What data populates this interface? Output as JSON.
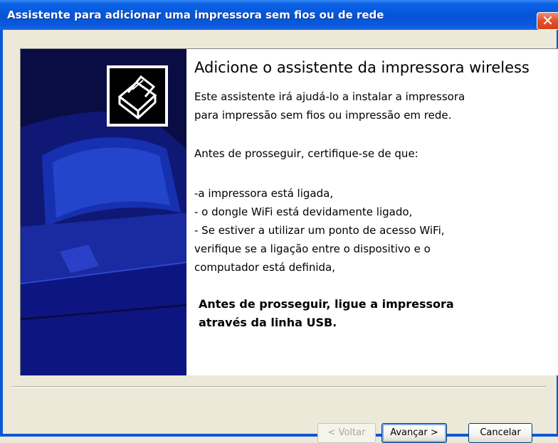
{
  "window": {
    "title": "Assistente para adicionar uma impressora sem fios ou de rede",
    "close_glyph": "✕"
  },
  "content": {
    "heading": "Adicione o assistente da impressora wireless",
    "intro_line1": "Este assistente irá ajudá-lo a instalar a impressora",
    "intro_line2": "para impressão sem fios ou impressão em rede.",
    "before_continue": "Antes de prosseguir, certifique-se de que:",
    "check1": "-a impressora está ligada,",
    "check2": "- o dongle WiFi está devidamente ligado,",
    "check3": "- Se estiver a utilizar um ponto de acesso WiFi,",
    "check4": "verifique se a ligação entre o dispositivo e o",
    "check5": "computador está definida,",
    "bold_line1": "Antes de prosseguir, ligue a impressora",
    "bold_line2": "através da linha USB."
  },
  "buttons": {
    "back": "< Voltar",
    "next": "Avançar >",
    "cancel": "Cancelar"
  },
  "icons": {
    "printer": "printer-icon",
    "close": "close-icon"
  },
  "colors": {
    "titlebar": "#0654d6",
    "side_art": "#0a0c44",
    "dialog_bg": "#ece9d8"
  }
}
